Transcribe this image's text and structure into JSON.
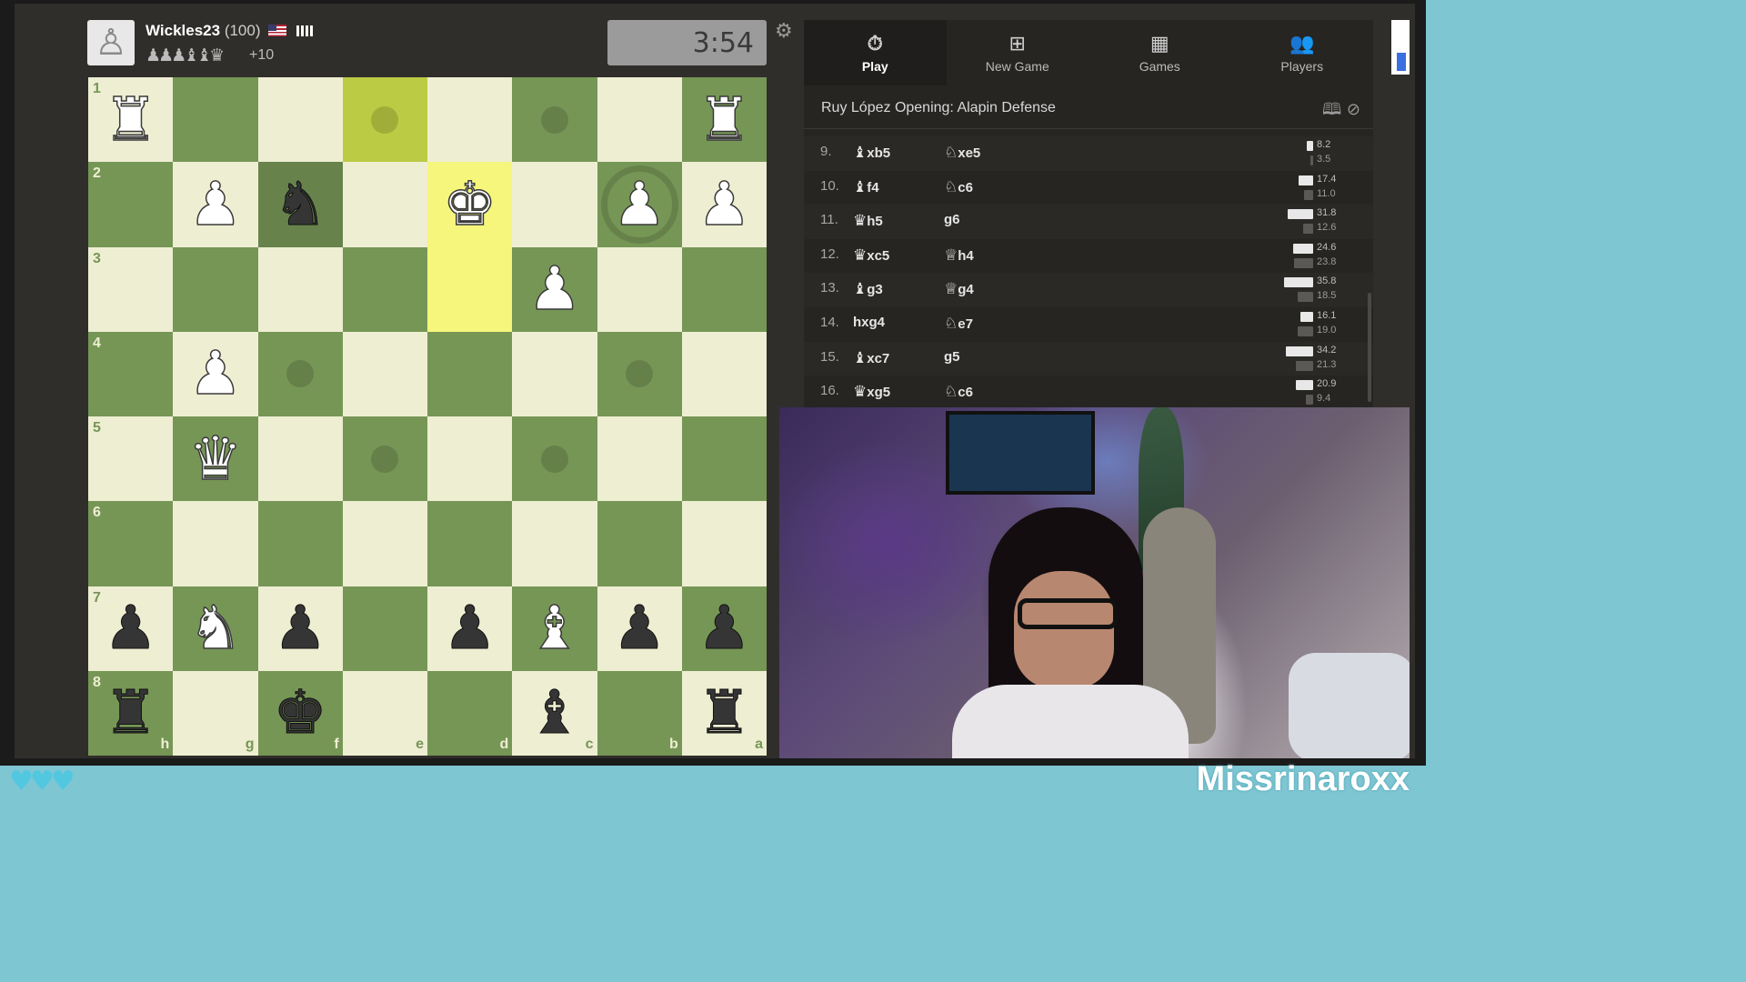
{
  "player": {
    "name": "Wickles23",
    "rating": "(100)",
    "captured_pieces": "♟♟♟♝♝♛",
    "material_advantage": "+10"
  },
  "clock": {
    "time": "3:54"
  },
  "icons": {
    "avatar": "pawn-avatar-icon",
    "settings": "gear-icon",
    "flag": "us-flag-icon",
    "connection": "signal-icon"
  },
  "board": {
    "ranks": [
      "1",
      "2",
      "3",
      "4",
      "5",
      "6",
      "7",
      "8"
    ],
    "files": [
      "h",
      "g",
      "f",
      "e",
      "d",
      "c",
      "b",
      "a"
    ],
    "rows": [
      [
        "wr",
        "",
        "",
        "",
        "",
        "",
        "",
        "wr"
      ],
      [
        "",
        "wp",
        "bn",
        "",
        "wk",
        "",
        "wp",
        "wp"
      ],
      [
        "",
        "",
        "",
        "",
        "",
        "wp",
        "",
        ""
      ],
      [
        "",
        "wp",
        "",
        "",
        "",
        "",
        "",
        ""
      ],
      [
        "",
        "wq",
        "",
        "",
        "",
        "",
        "",
        ""
      ],
      [
        "",
        "",
        "",
        "",
        "",
        "",
        "",
        ""
      ],
      [
        "bp",
        "wn",
        "bp",
        "",
        "bp",
        "wb",
        "bp",
        "bp"
      ],
      [
        "br",
        "",
        "bk",
        "",
        "",
        "bb",
        "",
        "br"
      ]
    ],
    "highlights": {
      "hl-dark": [
        [
          0,
          3
        ]
      ],
      "hl-light": [
        [
          1,
          4
        ],
        [
          2,
          4
        ]
      ]
    },
    "selected": [
      1,
      2
    ],
    "dots": [
      [
        0,
        3
      ],
      [
        0,
        5
      ],
      [
        3,
        2
      ],
      [
        3,
        6
      ],
      [
        4,
        3
      ],
      [
        4,
        5
      ]
    ],
    "rings": [
      [
        1,
        6
      ]
    ]
  },
  "nav": {
    "tabs": [
      {
        "label": "Play",
        "icon": "stopwatch-icon",
        "glyph": "⏱"
      },
      {
        "label": "New Game",
        "icon": "plus-icon",
        "glyph": "⊞"
      },
      {
        "label": "Games",
        "icon": "checkerboard-icon",
        "glyph": "▦"
      },
      {
        "label": "Players",
        "icon": "players-icon",
        "glyph": "👥"
      }
    ]
  },
  "opening": {
    "name": "Ruy López Opening: Alapin Defense",
    "icons": [
      "book-icon",
      "explorer-icon"
    ]
  },
  "moves": [
    {
      "num": "9.",
      "white_fig": "♝",
      "white": "xb5",
      "black_fig": "♘",
      "black": "xe5",
      "w_time": "8.2",
      "b_time": "3.5",
      "w_time_ratio": 0.23,
      "b_time_ratio": 0.1
    },
    {
      "num": "10.",
      "white_fig": "♝",
      "white": "f4",
      "black_fig": "♘",
      "black": "c6",
      "w_time": "17.4",
      "b_time": "11.0",
      "w_time_ratio": 0.49,
      "b_time_ratio": 0.31
    },
    {
      "num": "11.",
      "white_fig": "♛",
      "white": "h5",
      "black_fig": "",
      "black": "g6",
      "w_time": "31.8",
      "b_time": "12.6",
      "w_time_ratio": 0.89,
      "b_time_ratio": 0.35
    },
    {
      "num": "12.",
      "white_fig": "♛",
      "white": "xc5",
      "black_fig": "♕",
      "black": "h4",
      "w_time": "24.6",
      "b_time": "23.8",
      "w_time_ratio": 0.69,
      "b_time_ratio": 0.66
    },
    {
      "num": "13.",
      "white_fig": "♝",
      "white": "g3",
      "black_fig": "♕",
      "black": "g4",
      "w_time": "35.8",
      "b_time": "18.5",
      "w_time_ratio": 1.0,
      "b_time_ratio": 0.52
    },
    {
      "num": "14.",
      "white_fig": "",
      "white": "hxg4",
      "black_fig": "♘",
      "black": "e7",
      "w_time": "16.1",
      "b_time": "19.0",
      "w_time_ratio": 0.45,
      "b_time_ratio": 0.53
    },
    {
      "num": "15.",
      "white_fig": "♝",
      "white": "xc7",
      "black_fig": "",
      "black": "g5",
      "w_time": "34.2",
      "b_time": "21.3",
      "w_time_ratio": 0.95,
      "b_time_ratio": 0.59
    },
    {
      "num": "16.",
      "white_fig": "♛",
      "white": "xg5",
      "black_fig": "♘",
      "black": "c6",
      "w_time": "20.9",
      "b_time": "9.4",
      "w_time_ratio": 0.58,
      "b_time_ratio": 0.26
    }
  ],
  "overlay": {
    "channel_name": "Missrinaroxx",
    "hearts": "♥♥♥"
  },
  "colors": {
    "light_square": "#eeeed2",
    "dark_square": "#769656",
    "highlight": "#f6f67c",
    "panel_bg": "#262522",
    "overlay_accent": "#7fc6d3"
  }
}
